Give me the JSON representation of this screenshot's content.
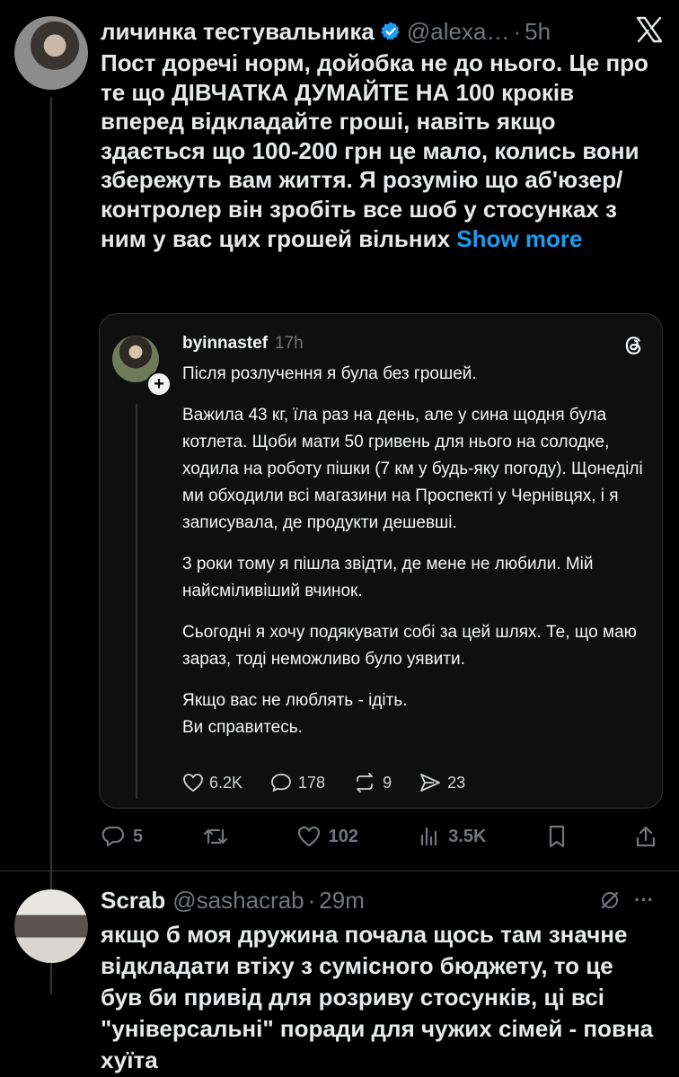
{
  "main_post": {
    "display_name": "личинка тестувальника",
    "handle": "@alexa…",
    "separator": "·",
    "time": "5h",
    "text": "Пост доречі норм, дойобка не до нього. Це про те що ДІВЧАТКА ДУМАЙТЕ НА 100 кроків вперед відкладайте гроші, навіть якщо здається що 100-200 грн це мало, колись вони збережуть вам життя. Я розумію що аб'юзер/контролер він зробіть все шоб у стосунках з ним у вас цих грошей вільних",
    "show_more": "Show more",
    "icons": {
      "verified": "verified-badge-icon",
      "close": "x-close-icon"
    }
  },
  "quote": {
    "username": "byinnastef",
    "time": "17h",
    "follow_icon": "+",
    "icon": "threads-logo-icon",
    "paragraphs": [
      "Після розлучення я була без грошей.",
      "Важила 43 кг, їла раз на день, але у сина щодня була котлета. Щоби мати 50 гривень для нього на солодке, ходила на роботу пішки (7 км у будь-яку погоду). Щонеділі ми обходили всі магазини на Проспекті у Чернівцях, і я записувала, де продукти дешевші.",
      "3 роки тому я пішла звідти, де мене не любили. Мій найсміливіший вчинок.",
      "Сьогодні я хочу подякувати собі за цей шлях. Те, що маю зараз, тоді неможливо було уявити.",
      "Якщо вас не люблять - ідіть.\nВи справитесь."
    ],
    "stats": {
      "likes": "6.2K",
      "comments": "178",
      "reposts": "9",
      "shares": "23"
    }
  },
  "actions": {
    "replies": "5",
    "reposts": "",
    "likes": "102",
    "views": "3.5K"
  },
  "reply": {
    "display_name": "Scrab",
    "handle": "@sashacrab",
    "separator": "·",
    "time": "29m",
    "more": "···",
    "text": "якщо б моя дружина почала щось там значне відкладати втіху з сумісного бюджету, то це був би привід для розриву стосунків, ці всі \"універсальні\" поради для чужих сімей - повна хуїта"
  }
}
